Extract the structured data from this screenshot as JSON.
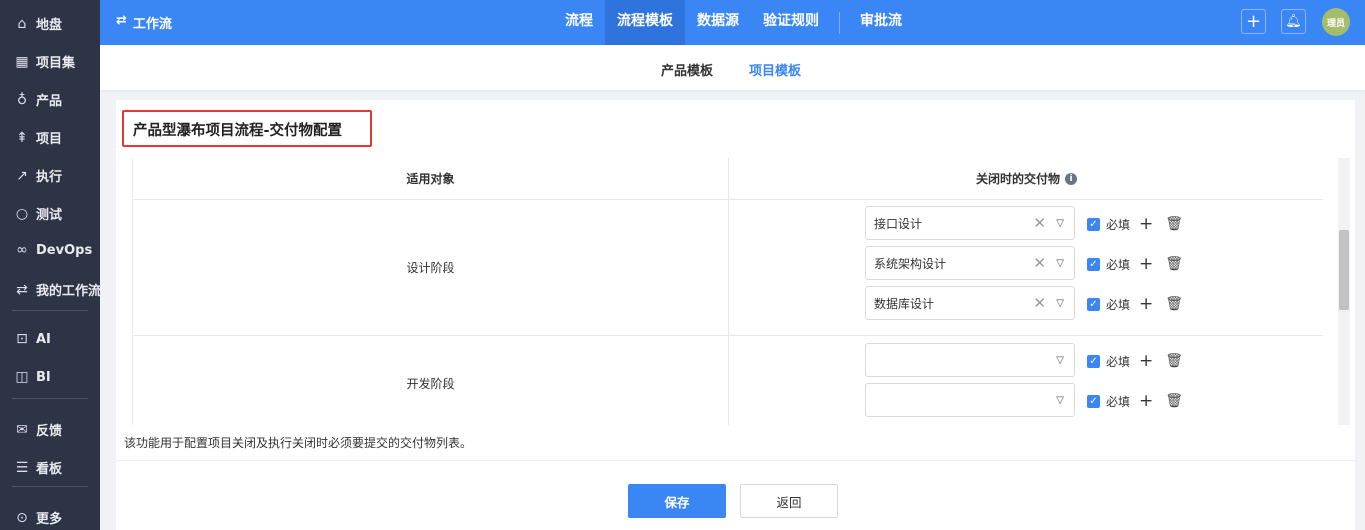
{
  "sidebar": {
    "items": [
      {
        "label": "地盘",
        "icon": "home-icon"
      },
      {
        "label": "项目集",
        "icon": "grid-icon"
      },
      {
        "label": "产品",
        "icon": "bulb-icon"
      },
      {
        "label": "项目",
        "icon": "rocket-icon"
      },
      {
        "label": "执行",
        "icon": "run-icon"
      },
      {
        "label": "测试",
        "icon": "search-icon"
      },
      {
        "label": "DevOps",
        "icon": "infinity-icon"
      },
      {
        "label": "我的工作流",
        "icon": "workflow-icon"
      },
      {
        "label": "AI",
        "icon": "robot-icon"
      },
      {
        "label": "BI",
        "icon": "chart-board-icon"
      },
      {
        "label": "反馈",
        "icon": "feedback-icon"
      },
      {
        "label": "看板",
        "icon": "kanban-icon"
      },
      {
        "label": "更多",
        "icon": "more-icon"
      }
    ]
  },
  "topbar": {
    "title": "工作流",
    "tabs": [
      "流程",
      "流程模板",
      "数据源",
      "验证规则",
      "审批流"
    ],
    "active_tab": "流程模板",
    "avatar": "理员"
  },
  "subnav": {
    "tabs": [
      "产品模板",
      "项目模板"
    ],
    "active": "项目模板"
  },
  "card": {
    "title": "产品型瀑布项目流程-交付物配置",
    "columns": [
      "适用对象",
      "关闭时的交付物"
    ],
    "rows": [
      {
        "stage": "设计阶段",
        "deliverables": [
          "接口设计",
          "系统架构设计",
          "数据库设计"
        ]
      },
      {
        "stage": "开发阶段",
        "deliverables": [
          "",
          ""
        ]
      }
    ],
    "required_label": "必填",
    "note": "该功能用于配置项目关闭及执行关闭时必须要提交的交付物列表。",
    "save": "保存",
    "back": "返回"
  },
  "colors": {
    "topbar": "#3a86f5",
    "sidebar": "#2e3446",
    "highlight": "#e53935"
  }
}
